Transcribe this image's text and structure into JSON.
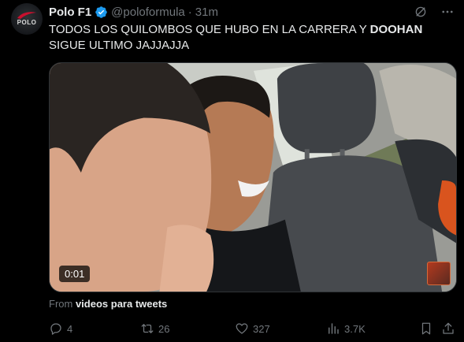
{
  "author": {
    "name": "Polo F1",
    "handle": "@poloformula",
    "separator": "·",
    "time": "31m",
    "avatar_text": "POLO"
  },
  "tweet": {
    "text_before": "TODOS LOS QUILOMBOS QUE HUBO EN LA CARRERA Y ",
    "text_bold": "DOOHAN",
    "text_after": " SIGUE ULTIMO JAJJAJJA"
  },
  "media": {
    "timestamp": "0:01"
  },
  "source": {
    "prefix": "From ",
    "name": "videos para tweets"
  },
  "actions": {
    "replies": "4",
    "retweets": "26",
    "likes": "327",
    "views": "3.7K"
  },
  "icons": {
    "verified": "verified-badge-icon",
    "grok": "grok-icon",
    "more": "more-icon",
    "reply": "reply-icon",
    "retweet": "retweet-icon",
    "like": "like-icon",
    "views": "views-icon",
    "bookmark": "bookmark-icon",
    "share": "share-icon"
  },
  "colors": {
    "background": "#000000",
    "text": "#e7e9ea",
    "muted": "#71767b",
    "verified": "#1d9bf0",
    "border": "#2f3336"
  }
}
